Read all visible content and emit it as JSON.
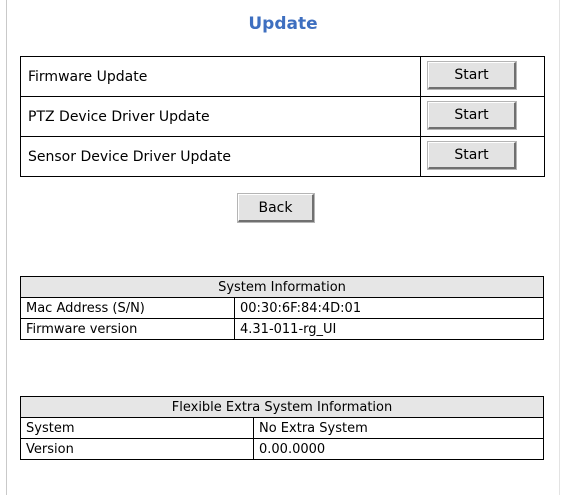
{
  "page": {
    "title": "Update"
  },
  "updates": [
    {
      "label": "Firmware Update",
      "button": "Start"
    },
    {
      "label": "PTZ Device Driver Update",
      "button": "Start"
    },
    {
      "label": "Sensor Device Driver Update",
      "button": "Start"
    }
  ],
  "back_label": "Back",
  "system_info": {
    "header": "System Information",
    "rows": [
      {
        "key": "Mac Address (S/N)",
        "value": "00:30:6F:84:4D:01"
      },
      {
        "key": "Firmware version",
        "value": "4.31-011-rg_UI"
      }
    ]
  },
  "extra_info": {
    "header": "Flexible Extra System Information",
    "rows": [
      {
        "key": "System",
        "value": "No Extra System"
      },
      {
        "key": "Version",
        "value": "0.00.0000"
      }
    ]
  }
}
